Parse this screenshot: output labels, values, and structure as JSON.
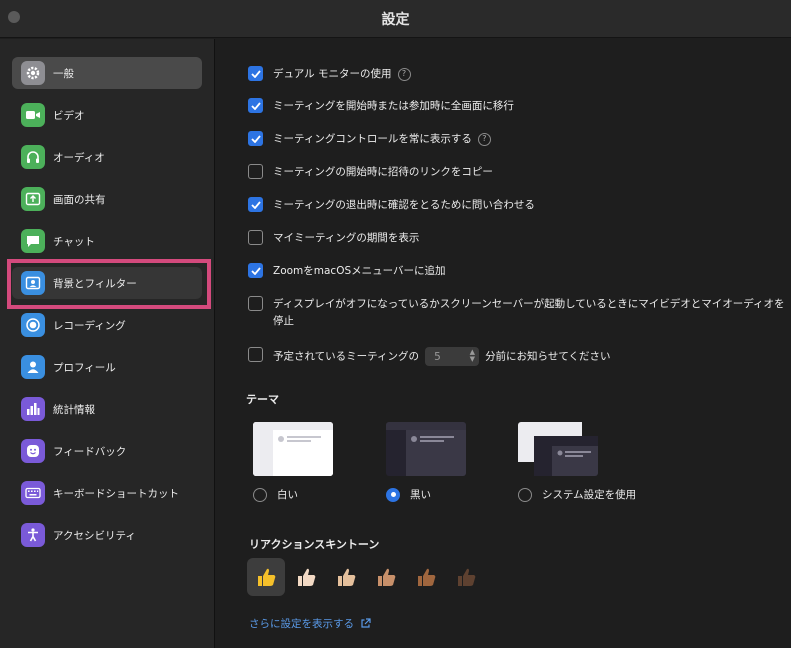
{
  "window": {
    "title": "設定"
  },
  "sidebar": {
    "items": [
      {
        "label": "一般",
        "icon": "gear-icon",
        "color": "#8e8e93"
      },
      {
        "label": "ビデオ",
        "icon": "video-camera-icon",
        "color": "#4cb05a"
      },
      {
        "label": "オーディオ",
        "icon": "headphones-icon",
        "color": "#4cb05a"
      },
      {
        "label": "画面の共有",
        "icon": "share-screen-icon",
        "color": "#4cb05a"
      },
      {
        "label": "チャット",
        "icon": "chat-bubble-icon",
        "color": "#4cb05a"
      },
      {
        "label": "背景とフィルター",
        "icon": "background-portrait-icon",
        "color": "#3a8fe0"
      },
      {
        "label": "レコーディング",
        "icon": "record-icon",
        "color": "#3a8fe0"
      },
      {
        "label": "プロフィール",
        "icon": "person-icon",
        "color": "#3a8fe0"
      },
      {
        "label": "統計情報",
        "icon": "bar-chart-icon",
        "color": "#7a5ad8"
      },
      {
        "label": "フィードバック",
        "icon": "smiley-icon",
        "color": "#7a5ad8"
      },
      {
        "label": "キーボードショートカット",
        "icon": "keyboard-icon",
        "color": "#7a5ad8"
      },
      {
        "label": "アクセシビリティ",
        "icon": "accessibility-icon",
        "color": "#7a5ad8"
      }
    ]
  },
  "options": [
    {
      "label": "デュアル モニターの使用",
      "checked": true,
      "help": true
    },
    {
      "label": "ミーティングを開始時または参加時に全画面に移行",
      "checked": true
    },
    {
      "label": "ミーティングコントロールを常に表示する",
      "checked": true,
      "help": true
    },
    {
      "label": "ミーティングの開始時に招待のリンクをコピー",
      "checked": false
    },
    {
      "label": "ミーティングの退出時に確認をとるために問い合わせる",
      "checked": true
    },
    {
      "label": "マイミーティングの期間を表示",
      "checked": false
    },
    {
      "label": "ZoomをmacOSメニューバーに追加",
      "checked": true
    },
    {
      "label": "ディスプレイがオフになっているかスクリーンセーバーが起動しているときにマイビデオとマイオーディオを停止",
      "checked": false
    },
    {
      "label_before": "予定されているミーティングの",
      "stepper_value": "5",
      "label_after": "分前にお知らせてください",
      "checked": false
    }
  ],
  "help_glyph": "?",
  "theme": {
    "title": "テーマ",
    "choices": [
      {
        "label": "白い",
        "selected": false
      },
      {
        "label": "黒い",
        "selected": true
      },
      {
        "label": "システム設定を使用",
        "selected": false
      }
    ]
  },
  "reactions": {
    "title": "リアクションスキントーン",
    "tones": [
      "#f5c02a",
      "#f2d9c4",
      "#e5c09c",
      "#c8906a",
      "#a0663e",
      "#5e4130"
    ],
    "selected_index": 0
  },
  "more_link": {
    "label": "さらに設定を表示する"
  },
  "colors": {
    "accent": "#2d74e3",
    "link": "#5a9ae8",
    "highlight_box": "#d44a7d"
  }
}
